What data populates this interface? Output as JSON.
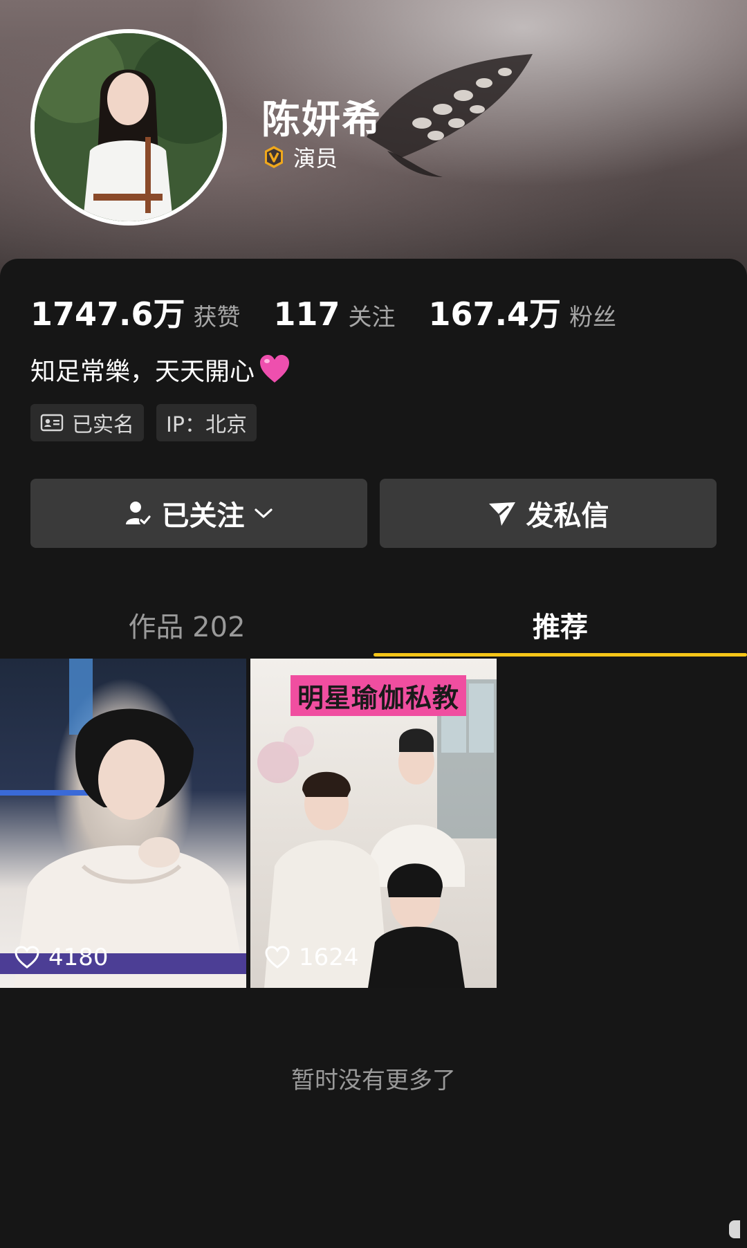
{
  "profile": {
    "name": "陈妍希",
    "verified_label": "演员",
    "verified_icon": "verified-v-icon"
  },
  "stats": [
    {
      "value": "1747.6万",
      "label": "获赞"
    },
    {
      "value": "117",
      "label": "关注"
    },
    {
      "value": "167.4万",
      "label": "粉丝"
    }
  ],
  "bio": {
    "text": "知足常樂，天天開心",
    "emoji": "pink-heart"
  },
  "tags": [
    {
      "icon": "id-card-icon",
      "label": "已实名"
    },
    {
      "label": "IP：北京"
    }
  ],
  "actions": {
    "follow_label": "已关注",
    "message_label": "发私信"
  },
  "tabs": [
    {
      "label": "作品 202",
      "active": false
    },
    {
      "label": "推荐",
      "active": true
    }
  ],
  "videos": [
    {
      "likes": "4180"
    },
    {
      "likes": "1624",
      "caption": "明星瑜伽私教"
    }
  ],
  "footer": {
    "no_more": "暂时没有更多了"
  },
  "colors": {
    "background": "#161616",
    "button": "#3a3a3a",
    "accent": "#f5c518",
    "verified": "#f0a81c",
    "banner_text_bg": "#f04ea0"
  }
}
